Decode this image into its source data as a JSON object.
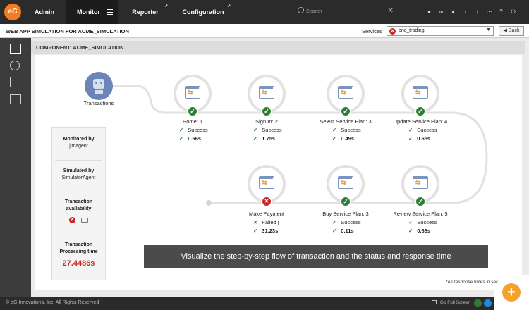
{
  "topbar": {
    "logo_text": "eG",
    "nav": [
      {
        "label": "Admin"
      },
      {
        "label": "Monitor"
      },
      {
        "label": "Reporter"
      },
      {
        "label": "Configuration"
      }
    ],
    "search_placeholder": "Search"
  },
  "header": {
    "title": "WEB APP SIMULATION FOR ACME_SIMULATION",
    "services_label": "Services",
    "service_value": "pnc_trading",
    "back_label": "Back"
  },
  "component": {
    "title": "COMPONENT: ACME_SIMULATION"
  },
  "flow": {
    "start_label": "Transactions",
    "steps": [
      {
        "name": "Home: 1",
        "status": "Success",
        "time": "0.66s"
      },
      {
        "name": "Sign In: 2",
        "status": "Success",
        "time": "1.75s"
      },
      {
        "name": "Select Service Plan: 3",
        "status": "Success",
        "time": "0.49s"
      },
      {
        "name": "Update Service Plan: 4",
        "status": "Success",
        "time": "0.65s"
      },
      {
        "name": "Make Payment",
        "status": "Failed",
        "time": "31.23s"
      },
      {
        "name": "Buy Service Plan: 3",
        "status": "Success",
        "time": "0.11s"
      },
      {
        "name": "Review Service Plan: 5",
        "status": "Success",
        "time": "0.68s"
      }
    ]
  },
  "info": {
    "monitored_by_label": "Monitored by",
    "monitored_by_value": "jimagent",
    "simulated_by_label": "Simulated by",
    "simulated_by_value": "SimulatorAgent",
    "availability_label": "Transaction availability",
    "processing_label": "Transaction Processing time",
    "processing_value": "27.4486s"
  },
  "caption": "Visualize the step-by-step flow of transaction and the status and response time",
  "footnote": "*All response times in seconds",
  "footer": {
    "copyright": "© eG Innovations, Inc. All Rights Reserved",
    "fullscreen": "Go Full Screen"
  },
  "colors": {
    "success": "#2e7d32",
    "failed": "#c62828",
    "accent": "#f4a22e"
  }
}
